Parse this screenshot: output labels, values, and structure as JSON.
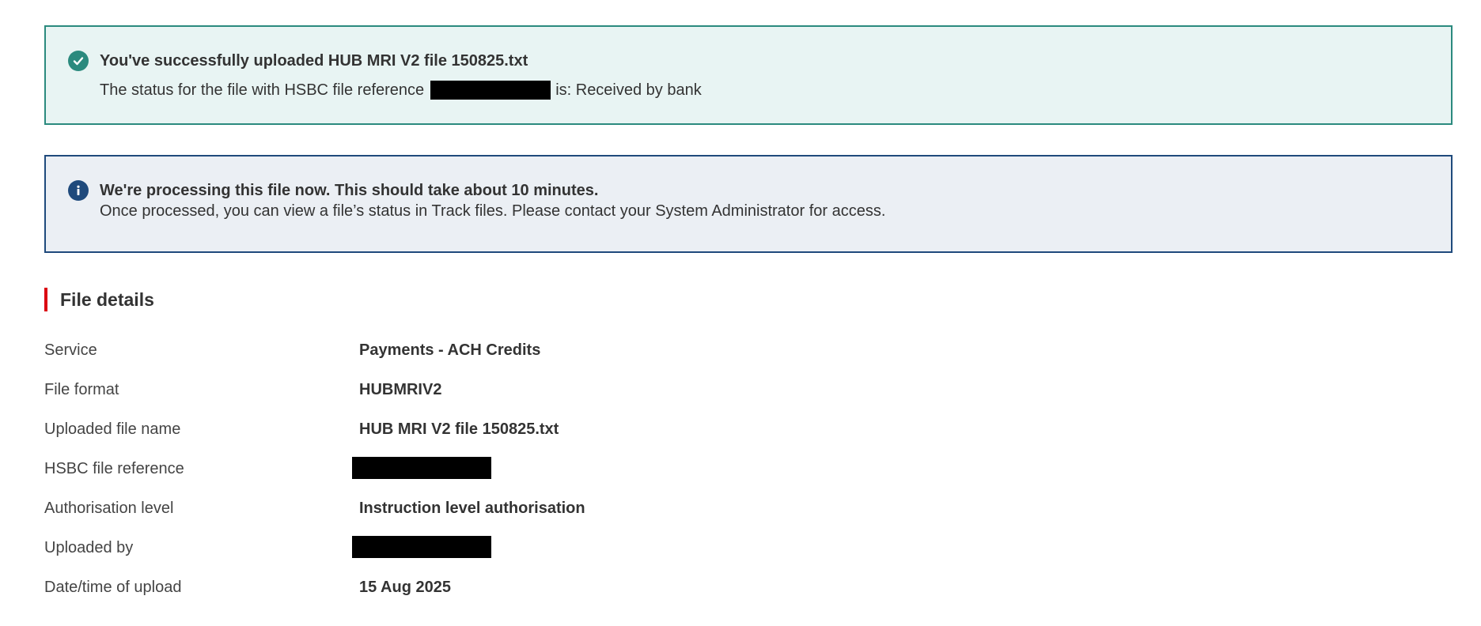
{
  "success_banner": {
    "icon": "check-circle-icon",
    "color": "#2b8a7e",
    "title": "You've successfully uploaded HUB MRI V2 file 150825.txt",
    "body_prefix": "The status for the file with HSBC file reference",
    "body_suffix": "is: Received by bank"
  },
  "info_banner": {
    "icon": "info-circle-icon",
    "color": "#1f4a7c",
    "title": "We're processing this file now. This should take about 10 minutes.",
    "body": "Once processed, you can view a file’s status in Track files. Please contact your System Administrator for access."
  },
  "file_details": {
    "heading": "File details",
    "accent_color": "#db0011",
    "rows": [
      {
        "label": "Service",
        "value": "Payments - ACH Credits"
      },
      {
        "label": "File format",
        "value": "HUBMRIV2"
      },
      {
        "label": "Uploaded file name",
        "value": "HUB MRI V2 file 150825.txt"
      },
      {
        "label": "HSBC file reference",
        "value": null
      },
      {
        "label": "Authorisation level",
        "value": "Instruction level authorisation"
      },
      {
        "label": "Uploaded by",
        "value": null
      },
      {
        "label": "Date/time of upload",
        "value": "15 Aug 2025"
      }
    ]
  }
}
